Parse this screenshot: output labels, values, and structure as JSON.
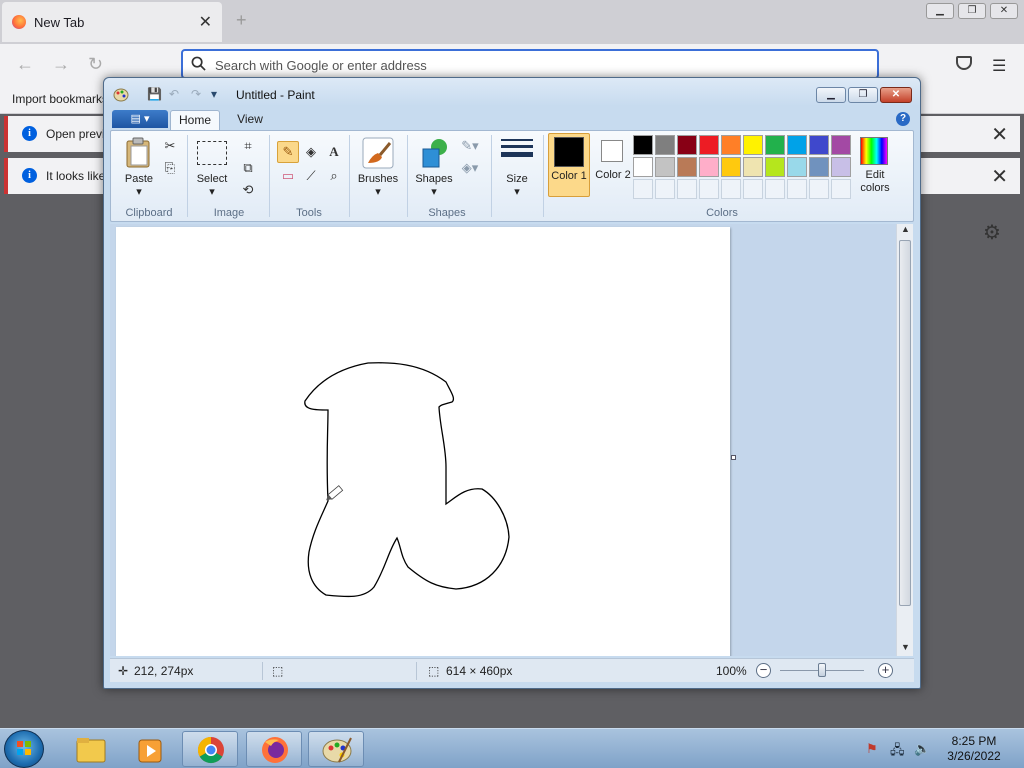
{
  "firefox": {
    "tab_title": "New Tab",
    "tab_close": "✕",
    "new_tab": "+",
    "url_placeholder": "Search with Google or enter address",
    "import_bookmarks": "Import bookmarks",
    "notice1": "Open previous",
    "notice2": "It looks like",
    "notice_close": "✕",
    "notice_info": "i",
    "win_min": "▁",
    "win_restore": "❐",
    "win_close": "✕",
    "back": "←",
    "forward": "→",
    "reload": "↻",
    "menu": "☰",
    "gear": "⚙"
  },
  "paint": {
    "title": "Untitled - Paint",
    "qat": {
      "save": "💾",
      "undo": "↶",
      "redo": "↷",
      "customize": "▾"
    },
    "win_min": "▁",
    "win_restore": "❐",
    "win_close": "✕",
    "file_menu": "▤ ▾",
    "tabs": [
      "Home",
      "View"
    ],
    "help": "?",
    "groups": {
      "clipboard": "Clipboard",
      "image": "Image",
      "tools": "Tools",
      "shapes": "Shapes",
      "colors": "Colors"
    },
    "buttons": {
      "paste": "Paste",
      "select": "Select",
      "brushes": "Brushes",
      "shapes": "Shapes",
      "size": "Size",
      "color1": "Color 1",
      "color2": "Color 2",
      "edit_colors": "Edit colors"
    },
    "tools": {
      "pencil": "✎",
      "fill": "◈",
      "text": "A",
      "eraser": "▭",
      "picker": "⟋",
      "magnifier": "⌕"
    },
    "color1": "#000000",
    "color2": "#ffffff",
    "palette_row1": [
      "#000000",
      "#7f7f7f",
      "#880015",
      "#ed1c24",
      "#ff7f27",
      "#fff200",
      "#22b14c",
      "#00a2e8",
      "#3f48cc",
      "#a349a4"
    ],
    "palette_row2": [
      "#ffffff",
      "#c3c3c3",
      "#b97a57",
      "#ffaec9",
      "#ffc90e",
      "#efe4b0",
      "#b5e61d",
      "#99d9ea",
      "#7092be",
      "#c8bfe7"
    ],
    "status": {
      "cursor_pos": "212, 274px",
      "canvas_size": "614 × 460px",
      "zoom": "100%",
      "zoom_out": "−",
      "zoom_in": "+"
    }
  },
  "taskbar": {
    "time": "8:25 PM",
    "date": "3/26/2022"
  }
}
